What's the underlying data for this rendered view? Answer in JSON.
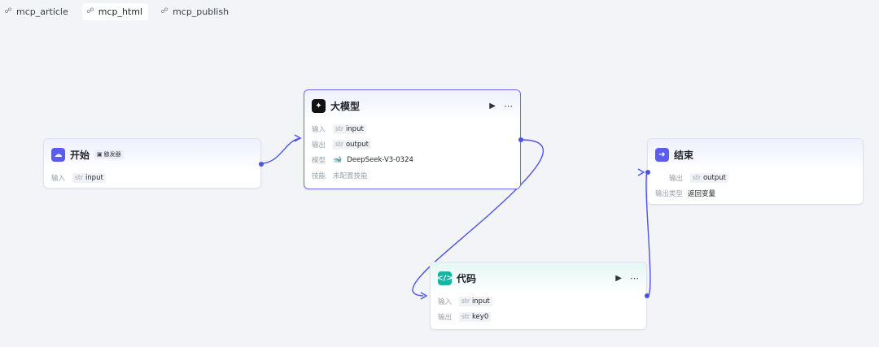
{
  "tabs": [
    {
      "label": "mcp_article",
      "icon": "workflow-icon",
      "active": false
    },
    {
      "label": "mcp_html",
      "icon": "workflow-icon",
      "active": true
    },
    {
      "label": "mcp_publish",
      "icon": "workflow-icon",
      "active": false
    }
  ],
  "nodes": {
    "start": {
      "title": "开始",
      "badge": "触发器",
      "input_label": "输入",
      "input_type": "str",
      "input_name": "input"
    },
    "llm": {
      "title": "大模型",
      "input_label": "输入",
      "input_type": "str",
      "input_name": "input",
      "output_label": "输出",
      "output_type": "str",
      "output_name": "output",
      "model_label": "模型",
      "model_name": "DeepSeek-V3-0324",
      "skill_label": "技能",
      "skill_value": "未配置技能"
    },
    "code": {
      "title": "代码",
      "input_label": "输入",
      "input_type": "str",
      "input_name": "input",
      "output_label": "输出",
      "output_type": "str",
      "output_name": "key0"
    },
    "end": {
      "title": "结束",
      "output_label": "输出",
      "output_type": "str",
      "output_name": "output",
      "output_kind_label": "输出类型",
      "output_kind_value": "返回变量"
    }
  },
  "colors": {
    "accent": "#4d53e8",
    "selected_border": "#6b6cf6",
    "code_icon": "#17b3a3"
  }
}
